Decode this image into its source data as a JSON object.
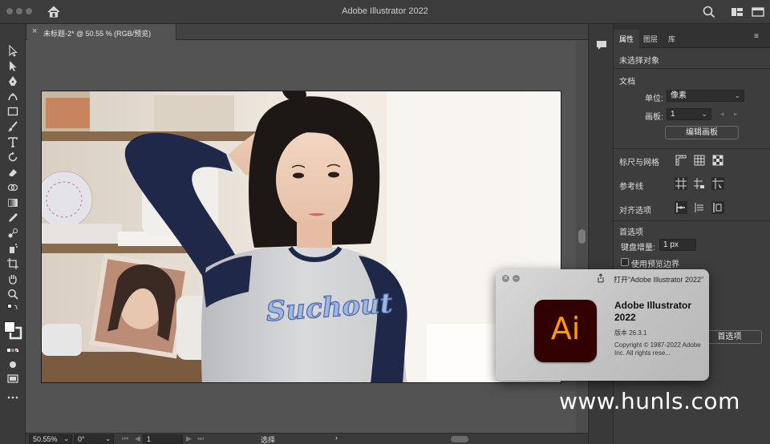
{
  "window": {
    "title": "Adobe Illustrator 2022"
  },
  "document_tab": {
    "close": "×",
    "title": "未标题-2* @ 50.55 % (RGB/预览)"
  },
  "status_bar": {
    "zoom": "50.55%",
    "rotation": "0°",
    "artboard_index": "1",
    "tool_name": "选择"
  },
  "properties_panel": {
    "tabs": [
      "属性",
      "图层",
      "库"
    ],
    "no_selection": "未选择对象",
    "document_section": "文档",
    "units_label": "单位:",
    "units_value": "像素",
    "artboard_label": "画板:",
    "artboard_value": "1",
    "edit_artboards_button": "编辑画板",
    "rulers_grids_label": "标尺与网格",
    "guides_label": "参考线",
    "snap_options_label": "对齐选项",
    "preferences_section": "首选项",
    "keyboard_increment_label": "键盘增量:",
    "keyboard_increment_value": "1 px",
    "preview_bounds_label": "使用预览边界",
    "preferences_button": "首选项"
  },
  "about_dialog": {
    "open_link": "打开“Adobe Illustrator 2022”",
    "logo_text": "Ai",
    "product_name": "Adobe Illustrator 2022",
    "version": "版本 26.3.1",
    "copyright": "Copyright © 1987-2022 Adobe Inc.  All rights rese..."
  },
  "artwork": {
    "shirt_text": "Suchout"
  },
  "watermark": "www.hunls.com",
  "colors": {
    "chrome": "#3c3c3c",
    "canvas": "#535353",
    "panel": "#3d3d3d",
    "ai_logo_bg": "#330000",
    "ai_logo_fg": "#ff9a00"
  }
}
